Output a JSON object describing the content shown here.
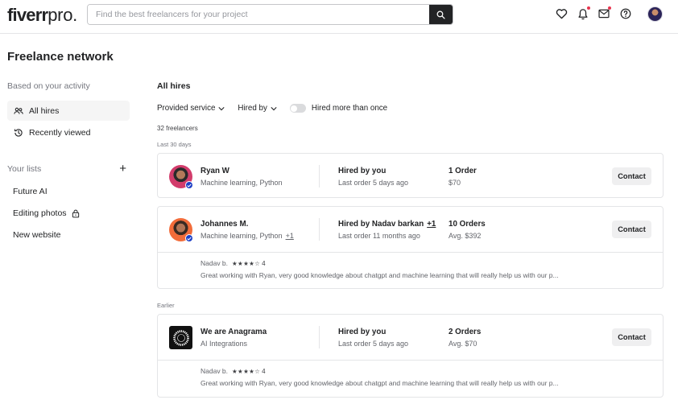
{
  "header": {
    "logo_main": "fiverr",
    "logo_suffix": "pro.",
    "search_placeholder": "Find the best freelancers for your project",
    "icons": [
      "heart-icon",
      "bell-icon",
      "mail-icon",
      "help-icon",
      "search-icon"
    ],
    "notification_dot_color": "#e8344e"
  },
  "sidebar": {
    "title": "Freelance network",
    "activity_label": "Based on your activity",
    "items": [
      {
        "label": "All hires",
        "icon": "users-icon",
        "active": true
      },
      {
        "label": "Recently viewed",
        "icon": "history-icon",
        "active": false
      }
    ],
    "lists_label": "Your lists",
    "add_symbol": "+",
    "lists": [
      {
        "label": "Future AI",
        "locked": false
      },
      {
        "label": "Editing photos",
        "locked": true
      },
      {
        "label": "New website",
        "locked": false
      }
    ]
  },
  "main": {
    "title": "All hires",
    "filters": {
      "provided_service": "Provided service",
      "hired_by": "Hired by",
      "toggle_label": "Hired more than once",
      "toggle_on": false
    },
    "count_label": "32 freelancers",
    "sections": [
      {
        "label": "Last 30 days"
      },
      {
        "label": "Earlier"
      }
    ],
    "contact_label": "Contact",
    "cards": [
      {
        "name": "Ryan W",
        "skills": "Machine learning, Python",
        "skills_more": "",
        "hired_by": "Hired by you",
        "hired_by_more": "",
        "last_order": "Last order 5 days ago",
        "orders": "1 Order",
        "price": "$70",
        "verified": true
      },
      {
        "name": "Johannes M.",
        "skills": "Machine learning, Python",
        "skills_more": "+1",
        "hired_by": "Hired by Nadav barkan",
        "hired_by_more": "+1",
        "last_order": "Last order 11 months ago",
        "orders": "10 Orders",
        "price": "Avg. $392",
        "verified": true,
        "review": {
          "author": "Nadav b.",
          "stars": "★★★★☆",
          "rating": "4",
          "text": "Great working with Ryan, very good knowledge about chatgpt and machine learning that will really help us with our p..."
        }
      },
      {
        "name": "We are Anagrama",
        "skills": "AI Integrations",
        "skills_more": "",
        "hired_by": "Hired by you",
        "hired_by_more": "",
        "last_order": "Last order 5 days ago",
        "orders": "2 Orders",
        "price": "Avg. $70",
        "verified": false,
        "review": {
          "author": "Nadav b.",
          "stars": "★★★★☆",
          "rating": "4",
          "text": "Great working with Ryan, very good knowledge about chatgpt and machine learning that will really help us with our p..."
        }
      }
    ]
  }
}
